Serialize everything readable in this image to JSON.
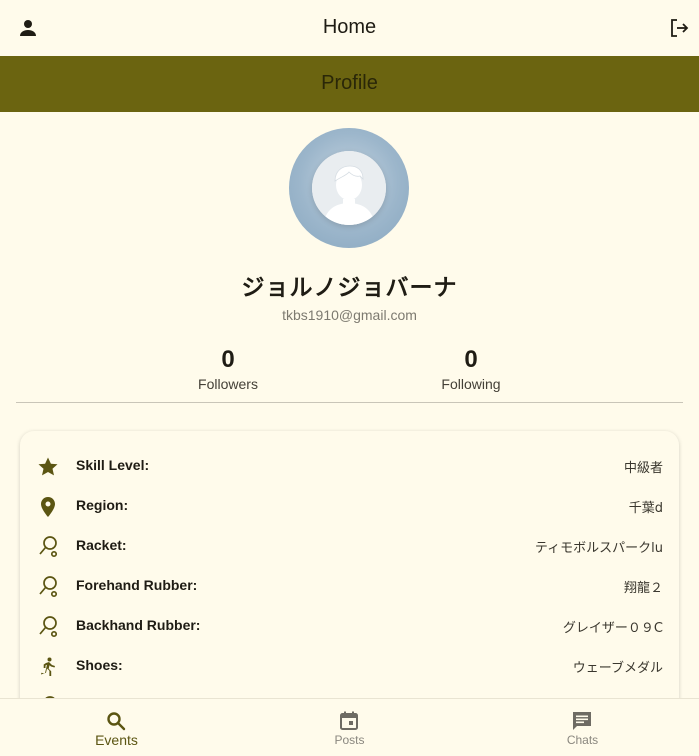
{
  "appbar": {
    "title": "Home",
    "profile_icon": "person-icon",
    "logout_icon": "logout-icon"
  },
  "subbar": {
    "title": "Profile"
  },
  "profile": {
    "avatar_icon": "default-avatar",
    "name": "ジョルノジョバーナ",
    "email": "tkbs1910@gmail.com",
    "followers": {
      "count": "0",
      "label": "Followers"
    },
    "following": {
      "count": "0",
      "label": "Following"
    }
  },
  "details": [
    {
      "icon": "star-icon",
      "label": "Skill Level:",
      "value": "中級者"
    },
    {
      "icon": "location-pin-icon",
      "label": "Region:",
      "value": "千葉d"
    },
    {
      "icon": "racket-icon",
      "label": "Racket:",
      "value": "ティモボルスパークlu"
    },
    {
      "icon": "racket-icon",
      "label": "Forehand Rubber:",
      "value": "翔龍２"
    },
    {
      "icon": "racket-icon",
      "label": "Backhand Rubber:",
      "value": "グレイザー０９C"
    },
    {
      "icon": "running-icon",
      "label": "Shoes:",
      "value": "ウェーブメダル"
    }
  ],
  "bottom_nav": [
    {
      "icon": "search-icon",
      "label": "Events",
      "active": true
    },
    {
      "icon": "calendar-icon",
      "label": "Posts",
      "active": false
    },
    {
      "icon": "chat-icon",
      "label": "Chats",
      "active": false
    }
  ],
  "colors": {
    "background": "#fffbeb",
    "accent": "#6b6410",
    "icon": "#5b5512"
  }
}
